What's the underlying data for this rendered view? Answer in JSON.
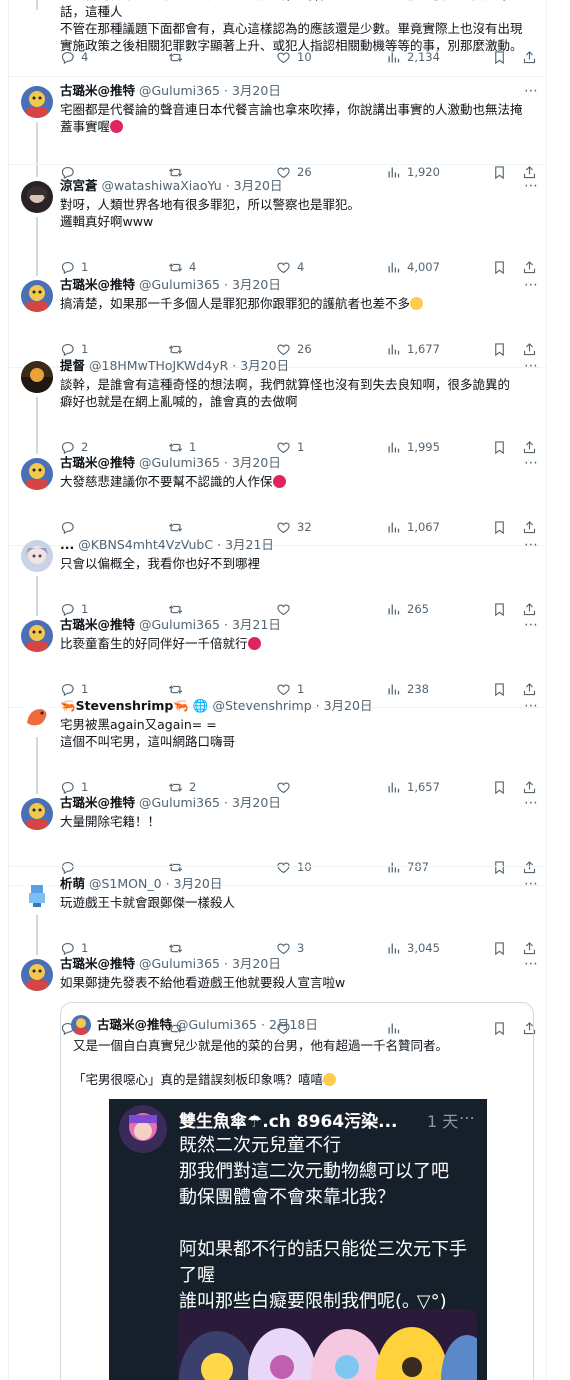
{
  "top_tweet": {
    "text_line1": "一如台灣日本有前輩的政黨主張那黨說出(戀母)，一般人也就是個以後一直被認為的話，這種人",
    "text_line2": "不管在那種議題下面都會有，真心這樣認為的應該還是少數。畢竟實際上也沒有出現",
    "text_line3": "實施政策之後相關犯罪數字顯著上升、或犯人指認相關動機等等的事，別那麼激動。",
    "replies": "4",
    "retweets": "",
    "likes": "10",
    "views": "2,134"
  },
  "tweets": [
    {
      "name": "古璐米@推特",
      "handle": "@Gulumi365",
      "date": "3月20日",
      "lines": [
        "宅圈都是代餐論的聲音連日本代餐言論也拿來吹捧，你說講出事實的人激動也無法掩",
        "蓋事實喔"
      ],
      "emoji": true,
      "replies": "",
      "retweets": "",
      "likes": "26",
      "views": "1,920"
    },
    {
      "name": "涼宮蒼",
      "handle": "@watashiwaXiaoYu",
      "date": "3月20日",
      "lines": [
        "對呀，人類世界各地有很多罪犯，所以警察也是罪犯。",
        "邏輯真好啊www"
      ],
      "emoji": false,
      "replies": "1",
      "retweets": "4",
      "likes": "4",
      "views": "4,007"
    },
    {
      "name": "古璐米@推特",
      "handle": "@Gulumi365",
      "date": "3月20日",
      "lines": [
        "搞清楚，如果那一千多個人是罪犯那你跟罪犯的護航者也差不多"
      ],
      "emoji": true,
      "replies": "1",
      "retweets": "",
      "likes": "26",
      "views": "1,677"
    },
    {
      "name": "提督",
      "handle": "@18HMwTHoJKWd4yR",
      "date": "3月20日",
      "lines": [
        "談幹，是誰會有這種奇怪的想法啊，我們就算怪也沒有到失去良知啊，很多詭異的",
        "癖好也就是在網上亂喊的，誰會真的去做啊"
      ],
      "emoji": false,
      "replies": "2",
      "retweets": "1",
      "likes": "1",
      "views": "1,995"
    },
    {
      "name": "古璐米@推特",
      "handle": "@Gulumi365",
      "date": "3月20日",
      "lines": [
        "大發慈悲建議你不要幫不認識的人作保"
      ],
      "emoji": true,
      "replies": "",
      "retweets": "",
      "likes": "32",
      "views": "1,067"
    },
    {
      "name": "...",
      "handle": "@KBNS4mht4VzVubC",
      "date": "3月21日",
      "lines": [
        "只會以偏概全，我看你也好不到哪裡"
      ],
      "emoji": false,
      "replies": "1",
      "retweets": "",
      "likes": "",
      "views": "265"
    },
    {
      "name": "古璐米@推特",
      "handle": "@Gulumi365",
      "date": "3月21日",
      "lines": [
        "比亵童畜生的好同伴好一千倍就行"
      ],
      "emoji": true,
      "replies": "1",
      "retweets": "",
      "likes": "1",
      "views": "238"
    },
    {
      "name": "Stevenshrimp",
      "handle": "@Stevenshrimp",
      "date": "3月20日",
      "lines": [
        "宅男被黑again又again= =",
        "這個不叫宅男，這叫網路口嗨哥"
      ],
      "emoji": false,
      "replies": "1",
      "retweets": "2",
      "likes": "",
      "views": "1,657"
    },
    {
      "name": "古璐米@推特",
      "handle": "@Gulumi365",
      "date": "3月20日",
      "lines": [
        "大量開除宅籍！！"
      ],
      "emoji": false,
      "replies": "",
      "retweets": "",
      "likes": "10",
      "views": "787"
    },
    {
      "name": "析萌",
      "handle": "@S1MON_0",
      "date": "3月20日",
      "lines": [
        "玩遊戲王卡就會跟鄭傑一樣殺人"
      ],
      "emoji": false,
      "replies": "1",
      "retweets": "",
      "likes": "3",
      "views": "3,045"
    },
    {
      "name": "古璐米@推特",
      "handle": "@Gulumi365",
      "date": "3月20日",
      "lines": [
        "如果鄭捷先發表不給他看遊戲王他就要殺人宣言啦w"
      ],
      "emoji": false,
      "replies": "",
      "retweets": "",
      "likes": "",
      "views": ""
    }
  ],
  "quote": {
    "name": "古璐米@推特",
    "handle": "@Gulumi365",
    "date": "2月18日",
    "line1": "又是一個自白真實兒少就是他的菜的台男，他有超過一千名贊同者。",
    "line2": "「宅男很噁心」真的是錯誤刻板印象嗎？嘻嘻",
    "shot": {
      "name": "雙生魚傘☂.ch 8964污染...",
      "time": "1 天",
      "text": "既然二次元兒童不行\n那我們對這二次元動物總可以了吧\n動保團體會不會來靠北我？\n\n阿如果都不行的話只能從三次元下手\n了喔\n誰叫那些白癡要限制我們呢(｡ ▽°)"
    }
  },
  "colors": {
    "text": "#0f1419",
    "muted": "#536471",
    "border": "#eff3f4",
    "thread": "#cfd9de",
    "blue": "#1d9bf0"
  }
}
